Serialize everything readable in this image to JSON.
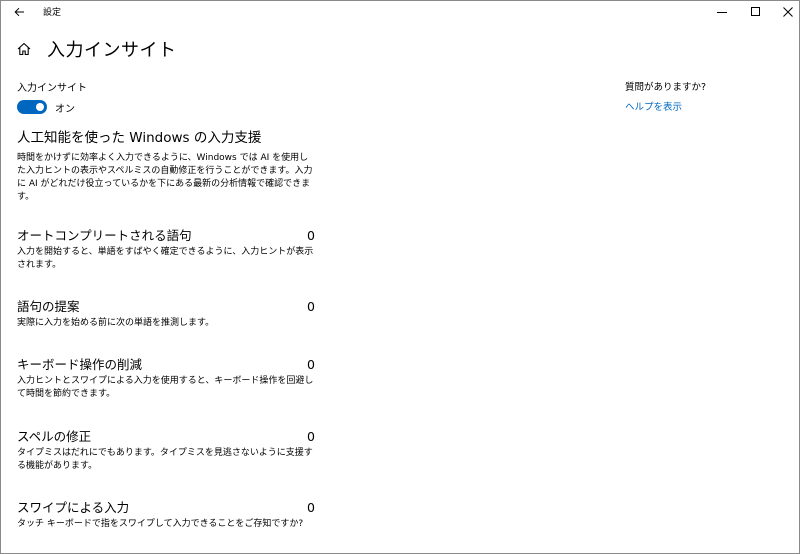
{
  "titlebar": {
    "app_title": "設定",
    "icons": [
      "back-arrow-icon",
      "minimize-icon",
      "maximize-icon",
      "close-icon"
    ]
  },
  "header": {
    "title": "入力インサイト",
    "icon": "home-icon"
  },
  "toggle": {
    "label": "入力インサイト",
    "state": "オン",
    "on": true,
    "color": "#0067c0"
  },
  "section": {
    "heading": "人工知能を使った Windows の入力支援",
    "description": "時間をかけずに効率よく入力できるように、Windows では AI を使用した入力ヒントの表示やスペルミスの自動修正を行うことができます。入力に AI がどれだけ役立っているかを下にある最新の分析情報で確認できます。"
  },
  "stats": [
    {
      "title": "オートコンプリートされる語句",
      "value": "0",
      "description": "入力を開始すると、単語をすばやく確定できるように、入力ヒントが表示されます。"
    },
    {
      "title": "語句の提案",
      "value": "0",
      "description": "実際に入力を始める前に次の単語を推測します。"
    },
    {
      "title": "キーボード操作の削減",
      "value": "0",
      "description": "入力ヒントとスワイプによる入力を使用すると、キーボード操作を回避して時間を節約できます。"
    },
    {
      "title": "スペルの修正",
      "value": "0",
      "description": "タイプミスはだれにでもあります。タイプミスを見逃さないように支援する機能があります。"
    },
    {
      "title": "スワイプによる入力",
      "value": "0",
      "description": "タッチ キーボードで指をスワイプして入力できることをご存知ですか?"
    }
  ],
  "side": {
    "question": "質問がありますか?",
    "link": "ヘルプを表示",
    "link_color": "#0067c0"
  }
}
